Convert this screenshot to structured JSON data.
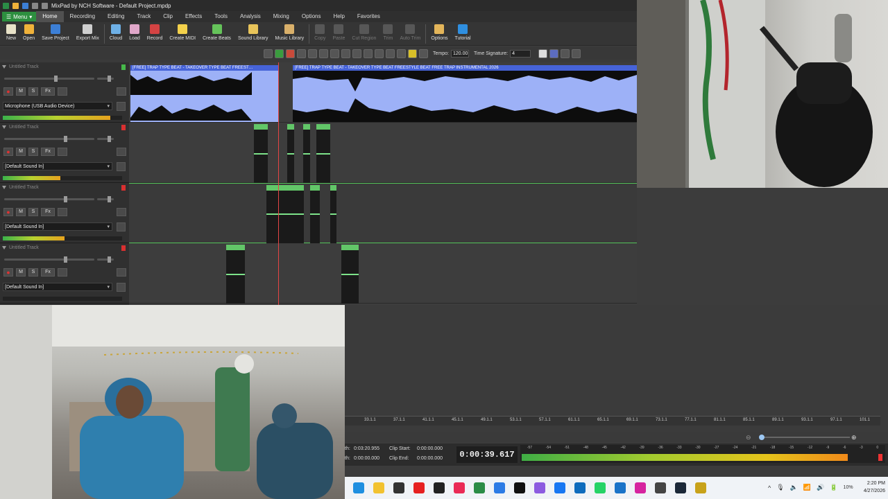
{
  "window": {
    "title": "MixPad by NCH Software - Default Project.mpdp"
  },
  "menu": {
    "button_label": "Menu",
    "items": [
      "Home",
      "Recording",
      "Editing",
      "Track",
      "Clip",
      "Effects",
      "Tools",
      "Analysis",
      "Mixing",
      "Options",
      "Help",
      "Favorites"
    ],
    "active": "Home"
  },
  "ribbon": {
    "buttons": [
      {
        "label": "New",
        "icon": "new-icon",
        "color": "#e8e2c8",
        "enabled": true
      },
      {
        "label": "Open",
        "icon": "open-folder-icon",
        "color": "#f0b23a",
        "enabled": true
      },
      {
        "label": "Save Project",
        "icon": "save-icon",
        "color": "#3c7fd6",
        "enabled": true
      },
      {
        "label": "Export Mix",
        "icon": "export-icon",
        "color": "#cfcfcf",
        "enabled": true
      },
      {
        "label": "Cloud",
        "icon": "cloud-icon",
        "color": "#6eb0e6",
        "enabled": true
      },
      {
        "label": "Load",
        "icon": "load-icon",
        "color": "#e0a7c9",
        "enabled": true
      },
      {
        "label": "Record",
        "icon": "record-icon",
        "color": "#d44343",
        "enabled": true
      },
      {
        "label": "Create MIDI",
        "icon": "midi-icon",
        "color": "#f3d14b",
        "enabled": true
      },
      {
        "label": "Create Beats",
        "icon": "beats-icon",
        "color": "#65c35a",
        "enabled": true
      },
      {
        "label": "Sound Library",
        "icon": "sound-library-icon",
        "color": "#e8c45a",
        "enabled": true
      },
      {
        "label": "Music Library",
        "icon": "music-library-icon",
        "color": "#d9b06a",
        "enabled": true
      },
      {
        "label": "Copy",
        "icon": "copy-icon",
        "color": "#999",
        "enabled": false
      },
      {
        "label": "Paste",
        "icon": "paste-icon",
        "color": "#999",
        "enabled": false
      },
      {
        "label": "Cut Region",
        "icon": "cut-region-icon",
        "color": "#999",
        "enabled": false
      },
      {
        "label": "Trim",
        "icon": "trim-icon",
        "color": "#999",
        "enabled": false
      },
      {
        "label": "Auto Trim",
        "icon": "auto-trim-icon",
        "color": "#999",
        "enabled": false
      },
      {
        "label": "Options",
        "icon": "options-icon",
        "color": "#e3b55a",
        "enabled": true
      },
      {
        "label": "Tutorial",
        "icon": "tutorial-icon",
        "color": "#2f8fe0",
        "enabled": true
      }
    ]
  },
  "toolbar2": {
    "tempo_label": "Tempo:",
    "tempo": "120.00",
    "timesig_label": "Time Signature:",
    "timesig": "4"
  },
  "tracks": [
    {
      "name": "Untitled Track",
      "device": "Microphone (USB Audio Device)",
      "level": 0.9,
      "side": "green"
    },
    {
      "name": "Untitled Track",
      "device": "[Default Sound In]",
      "level": 0.48,
      "side": "red"
    },
    {
      "name": "Untitled Track",
      "device": "[Default Sound In]",
      "level": 0.52,
      "side": "red"
    },
    {
      "name": "Untitled Track",
      "device": "[Default Sound In]",
      "level": 0.0,
      "side": "red"
    }
  ],
  "track_buttons": {
    "mute": "M",
    "solo": "S",
    "fx": "Fx"
  },
  "clips": {
    "beat_1": "[FREE] TRAP TYPE BEAT - TAKEOVER TYPE BEAT FREEST…",
    "beat_2": "[FREE] TRAP TYPE BEAT - TAKEOVER TYPE BEAT FREESTYLE BEAT FREE TRAP INSTRUMENTAL 2026"
  },
  "ruler": {
    "ticks": [
      "33.1.1",
      "37.1.1",
      "41.1.1",
      "45.1.1",
      "49.1.1",
      "53.1.1",
      "57.1.1",
      "61.1.1",
      "65.1.1",
      "69.1.1",
      "73.1.1",
      "77.1.1",
      "81.1.1",
      "85.1.1",
      "89.1.1",
      "93.1.1",
      "97.1.1",
      "101.1"
    ]
  },
  "info": {
    "length_label": "th:",
    "length": "0:03:20.955",
    "end_label": "th:",
    "end": "0:00:00.000",
    "clip_start_label": "Clip Start:",
    "clip_start": "0:00:00.000",
    "clip_end_label": "Clip End:",
    "clip_end": "0:00:00.000",
    "clock": "0:00:39.617"
  },
  "master_meter": {
    "labels": [
      "-57",
      "-54",
      "-51",
      "-48",
      "-45",
      "-42",
      "-39",
      "-36",
      "-33",
      "-30",
      "-27",
      "-24",
      "-21",
      "-18",
      "-15",
      "-12",
      "-9",
      "-6",
      "-3",
      "0"
    ],
    "level": 0.93
  },
  "taskbar": {
    "apps": [
      {
        "name": "edge-icon",
        "color": "#1f8fe0"
      },
      {
        "name": "file-explorer-icon",
        "color": "#f2c230"
      },
      {
        "name": "chrome-icon",
        "color": "#333"
      },
      {
        "name": "youtube-icon",
        "color": "#e62020"
      },
      {
        "name": "twitch-icon",
        "color": "#222"
      },
      {
        "name": "tiktok-icon",
        "color": "#ea2a55"
      },
      {
        "name": "mixpad-icon",
        "color": "#2b8c46"
      },
      {
        "name": "app-store-icon",
        "color": "#2c7be5"
      },
      {
        "name": "tiktok-dark-icon",
        "color": "#111"
      },
      {
        "name": "copilot-icon",
        "color": "#8c5be0"
      },
      {
        "name": "facebook-icon",
        "color": "#1877f2"
      },
      {
        "name": "outlook-icon",
        "color": "#0f6cbd"
      },
      {
        "name": "whatsapp-icon",
        "color": "#25d366"
      },
      {
        "name": "calendar-icon",
        "color": "#1a73c8"
      },
      {
        "name": "instagram-icon",
        "color": "#d6249f"
      },
      {
        "name": "chatgpt-icon",
        "color": "#444"
      },
      {
        "name": "steam-icon",
        "color": "#1b2838"
      },
      {
        "name": "nch-icon",
        "color": "#c8a21a"
      }
    ],
    "battery": "10%",
    "time": "2:20 PM",
    "date": "4/27/2026"
  }
}
